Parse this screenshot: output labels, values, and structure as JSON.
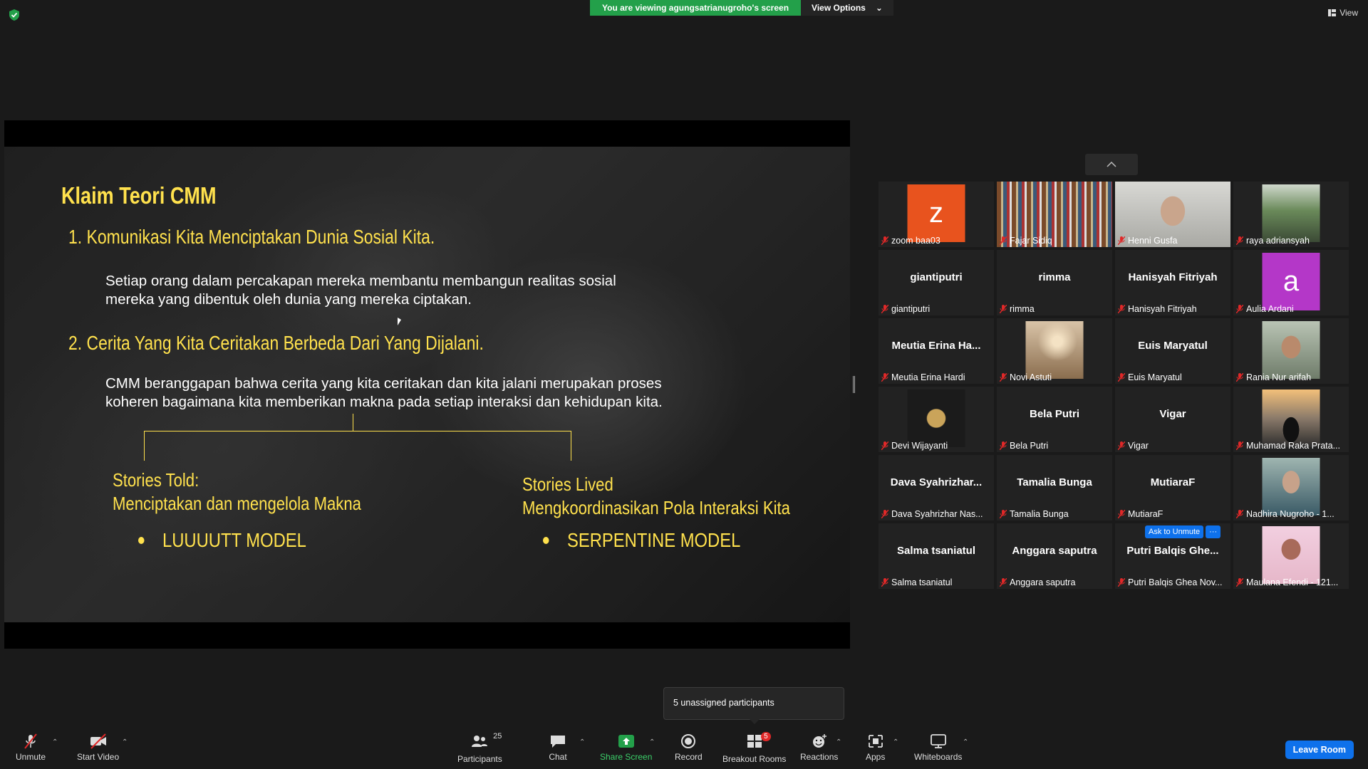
{
  "banner": {
    "viewing": "You are viewing agungsatrianugroho's screen",
    "options": "View Options"
  },
  "view_button": "View",
  "slide": {
    "title": "Klaim Teori CMM",
    "point1": "1.  Komunikasi Kita Menciptakan Dunia Sosial Kita.",
    "body1_line1": "Setiap orang dalam percakapan mereka membantu membangun realitas sosial",
    "body1_line2": "mereka yang dibentuk oleh dunia yang mereka ciptakan.",
    "point2": "2.  Cerita Yang Kita Ceritakan Berbeda Dari Yang Dijalani.",
    "body2_line1": "CMM beranggapan bahwa cerita yang kita ceritakan dan kita jalani merupakan proses",
    "body2_line2": "koheren bagaimana kita memberikan makna pada setiap interaksi dan kehidupan kita.",
    "left_heading": "Stories Told:",
    "left_sub": "Menciptakan dan mengelola Makna",
    "left_bullet": "LUUUUTT MODEL",
    "right_heading": "Stories Lived",
    "right_sub": "Mengkoordinasikan Pola Interaksi Kita",
    "right_bullet": "SERPENTINE MODEL"
  },
  "participants": [
    {
      "name": "zoom baa03",
      "display": "",
      "avatar": "z",
      "avatar_color": "#e8531e",
      "type": "letter"
    },
    {
      "name": "Fajar Sidiq",
      "display": "",
      "type": "photo",
      "photo": "bookshelf"
    },
    {
      "name": "Henni Gusfa",
      "display": "",
      "type": "photo",
      "photo": "person"
    },
    {
      "name": "raya adriansyah",
      "display": "",
      "type": "photo",
      "photo": "outdoor"
    },
    {
      "name": "giantiputri",
      "display": "giantiputri",
      "type": "name"
    },
    {
      "name": "rimma",
      "display": "rimma",
      "type": "name"
    },
    {
      "name": "Hanisyah Fitriyah",
      "display": "Hanisyah Fitriyah",
      "type": "name"
    },
    {
      "name": "Aulia Ardani",
      "display": "",
      "avatar": "a",
      "avatar_color": "#b437c8",
      "type": "letter"
    },
    {
      "name": "Meutia Erina Hardi",
      "display": "Meutia  Erina  Ha...",
      "type": "name"
    },
    {
      "name": "Novi Astuti",
      "display": "",
      "type": "photo",
      "photo": "sunset"
    },
    {
      "name": "Euis Maryatul",
      "display": "Euis Maryatul",
      "type": "name"
    },
    {
      "name": "Rania Nur arifah",
      "display": "",
      "type": "photo",
      "photo": "selfie"
    },
    {
      "name": "Devi Wijayanti",
      "display": "",
      "type": "photo",
      "photo": "logo"
    },
    {
      "name": "Bela Putri",
      "display": "Bela Putri",
      "type": "name"
    },
    {
      "name": "Vigar",
      "display": "Vigar",
      "type": "name"
    },
    {
      "name": "Muhamad Raka Prata...",
      "display": "",
      "type": "photo",
      "photo": "silhouette"
    },
    {
      "name": "Dava Syahrizhar Nas...",
      "display": "Dava  Syahrizhar...",
      "type": "name"
    },
    {
      "name": "Tamalia Bunga",
      "display": "Tamalia Bunga",
      "type": "name"
    },
    {
      "name": "MutiaraF",
      "display": "MutiaraF",
      "type": "name"
    },
    {
      "name": "Nadhira Nugroho - 1...",
      "display": "",
      "type": "photo",
      "photo": "girl"
    },
    {
      "name": "Salma tsaniatul",
      "display": "Salma tsaniatul",
      "type": "name"
    },
    {
      "name": "Anggara saputra",
      "display": "Anggara saputra",
      "type": "name"
    },
    {
      "name": "Putri Balqis Ghea Nov...",
      "display": "Putri  Balqis  Ghe...",
      "type": "name",
      "ask_unmute": "Ask to Unmute",
      "more": "···"
    },
    {
      "name": "Maulana Efendi - 121...",
      "display": "",
      "type": "photo",
      "photo": "pink"
    }
  ],
  "tooltip": "5 unassigned participants",
  "toolbar": {
    "unmute": "Unmute",
    "start_video": "Start Video",
    "participants": "Participants",
    "participants_count": "25",
    "chat": "Chat",
    "share_screen": "Share Screen",
    "record": "Record",
    "breakout_rooms": "Breakout Rooms",
    "breakout_badge": "5",
    "reactions": "Reactions",
    "apps": "Apps",
    "whiteboards": "Whiteboards",
    "leave": "Leave Room"
  },
  "colors": {
    "accent_green": "#23a04a",
    "accent_blue": "#0e71eb",
    "slide_yellow": "#ffe14d",
    "mute_red": "#e02828"
  }
}
